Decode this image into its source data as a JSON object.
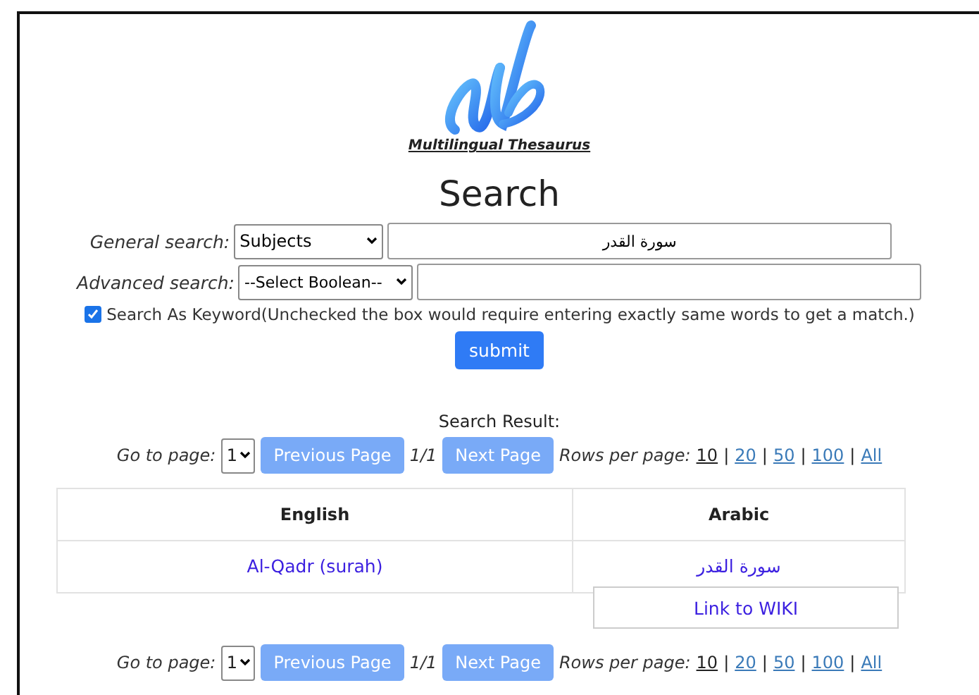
{
  "logo": {
    "caption": "Multilingual Thesaurus"
  },
  "title": "Search",
  "general_search": {
    "label": "General search:",
    "select": "Subjects",
    "value": "سورة القدر"
  },
  "advanced_search": {
    "label": "Advanced search:",
    "select": "--Select Boolean--"
  },
  "keyword_option": {
    "label": "Search As Keyword(Unchecked the box would require entering exactly same words to get a match.)",
    "checked": true
  },
  "submit": "submit",
  "result_heading": "Search Result:",
  "paginations": [
    {
      "go_label": "Go to page:",
      "page": "1",
      "prev": "Previous Page",
      "count": "1/1",
      "next": "Next Page",
      "rows_label": "Rows per page:",
      "rows_options": [
        {
          "label": "10",
          "selected": true
        },
        {
          "label": "20",
          "selected": false
        },
        {
          "label": "50",
          "selected": false
        },
        {
          "label": "100",
          "selected": false
        },
        {
          "label": "All",
          "selected": false
        }
      ],
      "separator": "|"
    },
    {
      "go_label": "Go to page:",
      "page": "1",
      "prev": "Previous Page",
      "count": "1/1",
      "next": "Next Page",
      "rows_label": "Rows per page:",
      "rows_options": [
        {
          "label": "10",
          "selected": true
        },
        {
          "label": "20",
          "selected": false
        },
        {
          "label": "50",
          "selected": false
        },
        {
          "label": "100",
          "selected": false
        },
        {
          "label": "All",
          "selected": false
        }
      ],
      "separator": "|"
    }
  ],
  "table": {
    "columns": [
      "English",
      "Arabic"
    ],
    "rows": [
      {
        "cells": [
          "Al-Qadr (surah)",
          "سورة القدر"
        ]
      }
    ]
  },
  "popup": {
    "link": "Link to WIKI"
  }
}
